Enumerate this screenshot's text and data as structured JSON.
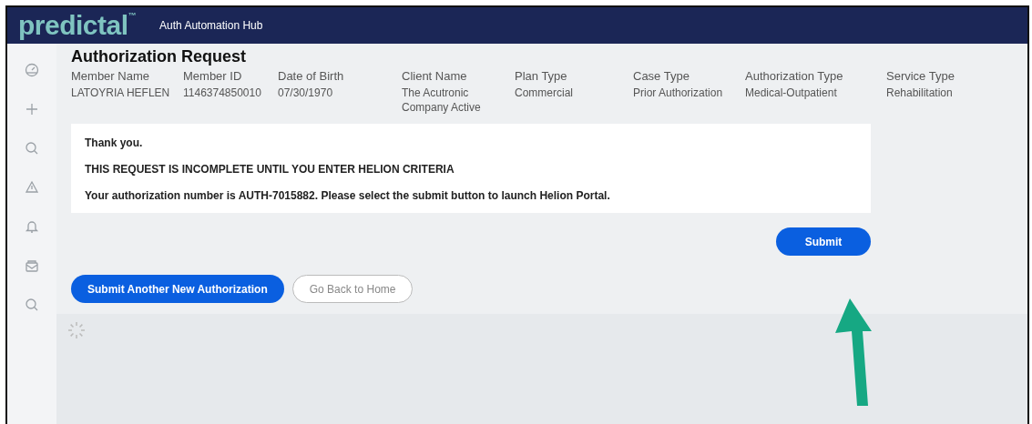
{
  "header": {
    "logo": "predictal$^{™}$",
    "app_title": "Auth Automation Hub"
  },
  "sidebar": {
    "items": [
      {
        "kind": "gauge"
      },
      {
        "kind": "plus"
      },
      {
        "kind": "search"
      },
      {
        "kind": "warning"
      },
      {
        "kind": "bell"
      },
      {
        "kind": "inbox"
      },
      {
        "kind": "search"
      }
    ]
  },
  "title": "Authorization Request",
  "fields": [
    {
      "label": "Member Name",
      "value": "LATOYRIA HEFLEN"
    },
    {
      "label": "Member ID",
      "value": "1146374850010"
    },
    {
      "label": "Date of Birth",
      "value": "07/30/1970"
    },
    {
      "label": "Client Name",
      "value": "The Acutronic Company Active"
    },
    {
      "label": "Plan Type",
      "value": "Commercial"
    },
    {
      "label": "Case Type",
      "value": "Prior Authorization"
    },
    {
      "label": "Authorization Type",
      "value": "Medical-Outpatient"
    },
    {
      "label": "Service Type",
      "value": "Rehabilitation"
    }
  ],
  "messages": [
    "Thank you.",
    "THIS REQUEST IS INCOMPLETE UNTIL YOU ENTER HELION CRITERIA",
    "Your authorization number is AUTH-7015882. Please select the submit button to launch Helion Portal."
  ],
  "submit_button": "Submit",
  "actions": [
    {
      "label": "Submit Another New Authorization",
      "kind": "primary"
    },
    {
      "label": "Go Back to Home",
      "kind": "outline"
    }
  ]
}
